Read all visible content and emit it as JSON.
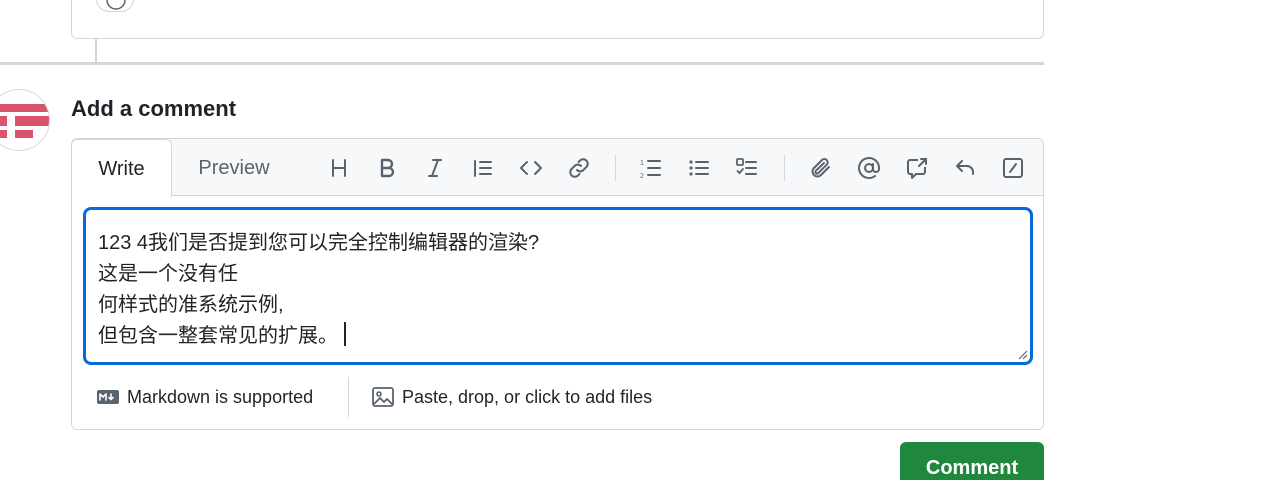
{
  "comment": {
    "heading": "Add a comment",
    "tabs": [
      {
        "label": "Write",
        "active": true
      },
      {
        "label": "Preview",
        "active": false
      }
    ],
    "toolbar": {
      "icons": [
        "heading-icon",
        "bold-icon",
        "italic-icon",
        "quote-icon",
        "code-icon",
        "link-icon",
        "ordered-list-icon",
        "unordered-list-icon",
        "task-list-icon",
        "attach-icon",
        "mention-icon",
        "cross-reference-icon",
        "saved-replies-icon",
        "slash-commands-icon"
      ]
    },
    "textarea": {
      "lines": [
        "123 4我们是否提到您可以完全控制编辑器的渲染?",
        "这是一个没有任",
        "何样式的准系统示例,",
        "但包含一整套常见的扩展。"
      ]
    },
    "footer": {
      "markdown_label": "Markdown is supported",
      "files_label": "Paste, drop, or click to add files"
    },
    "submit_label": "Comment"
  },
  "colors": {
    "accent_blue": "#0969da",
    "primary_green": "#1f883d",
    "border": "#d0d7de",
    "header_bg": "#f6f8fa",
    "avatar_red": "#d9546b"
  }
}
